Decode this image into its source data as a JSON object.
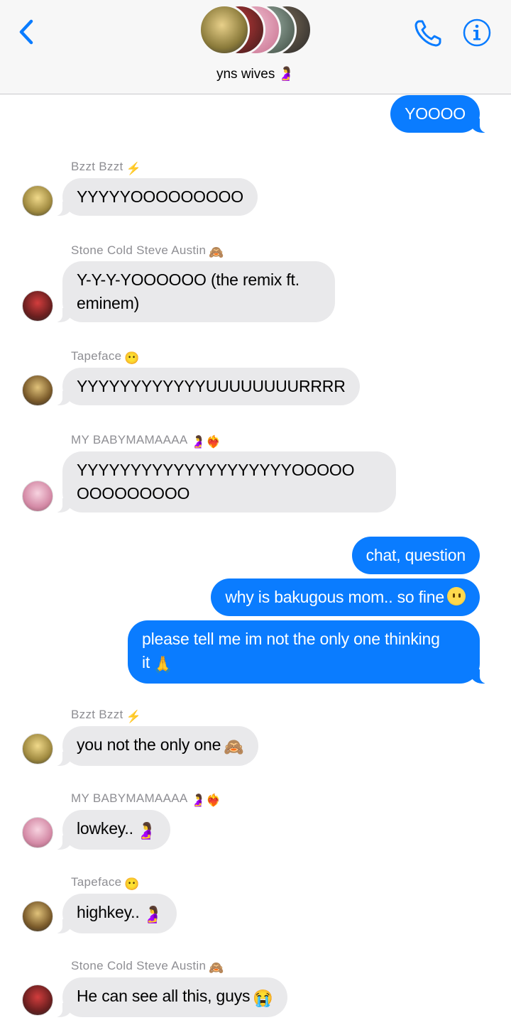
{
  "header": {
    "group_name": "yns wives",
    "group_emoji": "🤰"
  },
  "messages": {
    "m1": "YOOOO",
    "m2_sender": "Bzzt Bzzt",
    "m2_sender_emoji": "⚡",
    "m2": "YYYYYOOOOOOOOO",
    "m3_sender": "Stone Cold Steve Austin",
    "m3_sender_emoji": "🙈",
    "m3_line1": "Y-Y-Y-YOOOOOO (the remix ft.",
    "m3_line2": "eminem)",
    "m4_sender": "Tapeface",
    "m4_sender_emoji": "😶",
    "m4": "YYYYYYYYYYYYUUUUUUUURRRR",
    "m5_sender": "MY BABYMAMAAAA",
    "m5_sender_emoji": "🤰❤️‍🔥",
    "m5_line1": "YYYYYYYYYYYYYYYYYYYYOOOOO",
    "m5_line2": "OOOOOOOOO",
    "m6": "chat, question",
    "m7": "why is bakugous mom.. so fine",
    "m7_emoji": "😶",
    "m8_line1": "please tell me im not the only one thinking",
    "m8_line2": "it",
    "m8_emoji": "🙏",
    "m9_sender": "Bzzt Bzzt",
    "m9_sender_emoji": "⚡",
    "m9": "you not the only one",
    "m9_emoji": "🙈",
    "m10_sender": "MY BABYMAMAAAA",
    "m10_sender_emoji": "🤰❤️‍🔥",
    "m10": "lowkey..",
    "m10_emoji": "🤰",
    "m11_sender": "Tapeface",
    "m11_sender_emoji": "😶",
    "m11": "highkey..",
    "m11_emoji": "🤰",
    "m12_sender": "Stone Cold Steve Austin",
    "m12_sender_emoji": "🙈",
    "m12": "He can see all this, guys",
    "m12_emoji": "😭"
  },
  "colors": {
    "outgoing_bubble": "#0a7cff",
    "incoming_bubble": "#e9e9eb",
    "accent": "#0a7cff",
    "sender_gray": "#8e8e93"
  }
}
